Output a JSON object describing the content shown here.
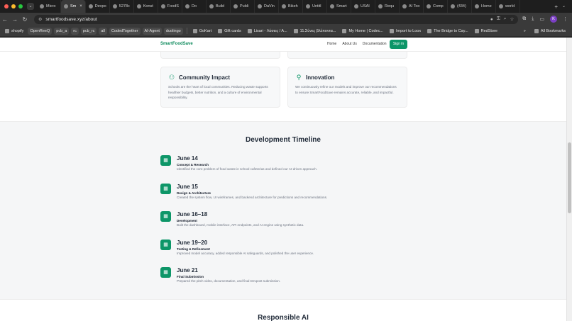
{
  "browser": {
    "tabs": [
      {
        "label": "Micro",
        "active": false
      },
      {
        "label": "Sm",
        "active": true
      },
      {
        "label": "Devpo",
        "active": false
      },
      {
        "label": "5278c",
        "active": false
      },
      {
        "label": "Konst",
        "active": false
      },
      {
        "label": "FoodS",
        "active": false
      },
      {
        "label": "Do",
        "active": false
      },
      {
        "label": "Build",
        "active": false
      },
      {
        "label": "Publi",
        "active": false
      },
      {
        "label": "DaVin",
        "active": false
      },
      {
        "label": "Bikeh",
        "active": false
      },
      {
        "label": "Untitl",
        "active": false
      },
      {
        "label": "Smart",
        "active": false
      },
      {
        "label": "USAI",
        "active": false
      },
      {
        "label": "Requ",
        "active": false
      },
      {
        "label": "AI Too",
        "active": false
      },
      {
        "label": "Comp",
        "active": false
      },
      {
        "label": "(434)",
        "active": false
      },
      {
        "label": "Home",
        "active": false
      },
      {
        "label": "world",
        "active": false
      }
    ],
    "url": "smartfoodsave.xyz/about",
    "profile_initial": "K",
    "bookmarks": [
      {
        "label": "shopify",
        "pill": false
      },
      {
        "label": "OpenReeQ",
        "pill": true
      },
      {
        "label": "pcb_a",
        "pill": true
      },
      {
        "label": "rc",
        "pill": true
      },
      {
        "label": "pcb_rc",
        "pill": true
      },
      {
        "label": "all",
        "pill": true
      },
      {
        "label": "CodedTogether",
        "pill": true
      },
      {
        "label": "AI-Agent",
        "pill": true
      },
      {
        "label": "duolingo",
        "pill": true
      },
      {
        "label": "GoKart",
        "pill": false
      },
      {
        "label": "Gift cards",
        "pill": false
      },
      {
        "label": "Lisari - Λύσεις / Α...",
        "pill": false
      },
      {
        "label": "11.Σύνες βλέποντα...",
        "pill": false
      },
      {
        "label": "My Home | Codec...",
        "pill": false
      },
      {
        "label": "Import to Loox",
        "pill": false
      },
      {
        "label": "The Bridge to Cay...",
        "pill": false
      },
      {
        "label": "RedStore",
        "pill": false
      }
    ],
    "all_bookmarks": "All Bookmarks"
  },
  "site": {
    "logo": "SmartFoodSave",
    "nav": [
      "Home",
      "About Us",
      "Documentation"
    ],
    "signin": "Sign in"
  },
  "cards": [
    {
      "icon": "people-icon",
      "title": "Community Impact",
      "body": "Schools are the heart of local communities. Reducing waste supports healthier budgets, better nutrition, and a culture of environmental responsibility."
    },
    {
      "icon": "lightbulb-icon",
      "title": "Innovation",
      "body": "We continuously refine our models and improve our recommendations to ensure SmartFoodSave remains accurate, reliable, and impactful."
    }
  ],
  "timeline": {
    "title": "Development Timeline",
    "items": [
      {
        "date": "June 14",
        "label": "Concept & Research",
        "desc": "Identified the core problem of food waste in school cafeterias and defined our AI-driven approach."
      },
      {
        "date": "June 15",
        "label": "Design & Architecture",
        "desc": "Created the system flow, UI wireframes, and backend architecture for predictions and recommendations."
      },
      {
        "date": "June 16–18",
        "label": "Development",
        "desc": "Built the dashboard, mobile interface, API endpoints, and AI engine using synthetic data."
      },
      {
        "date": "June 19–20",
        "label": "Testing & Refinement",
        "desc": "Improved model accuracy, added responsible AI safeguards, and polished the user experience."
      },
      {
        "date": "June 21",
        "label": "Final Submission",
        "desc": "Prepared the pitch video, documentation, and final Devpost submission."
      }
    ]
  },
  "responsible_ai": {
    "title": "Responsible AI"
  }
}
